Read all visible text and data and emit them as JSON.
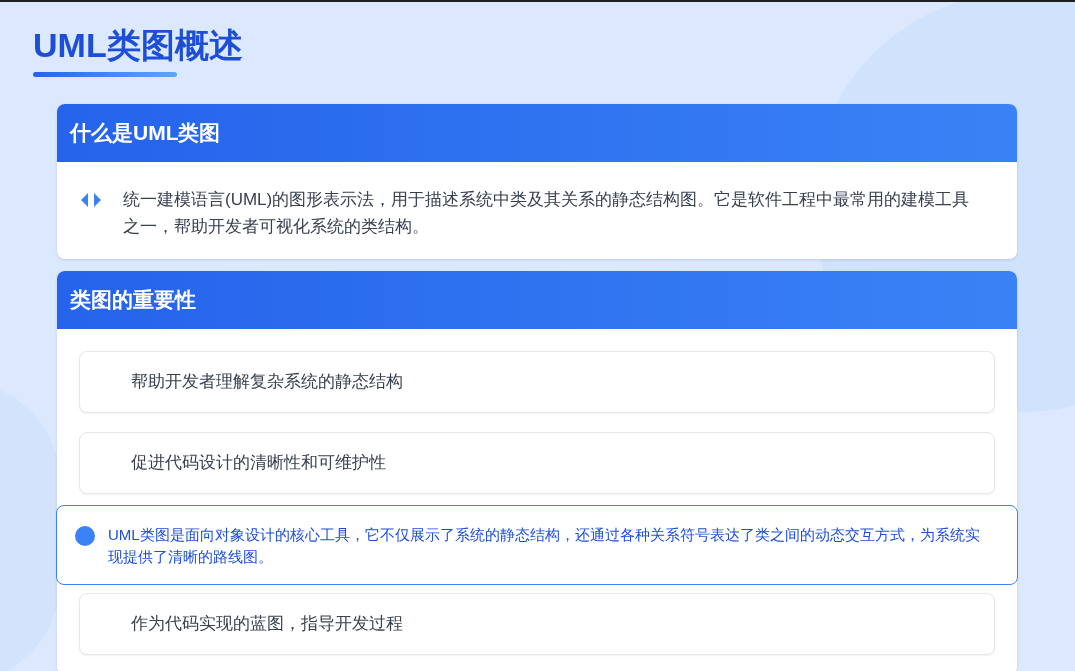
{
  "title": "UML类图概述",
  "sections": [
    {
      "heading": "什么是UML类图",
      "kind": "definition",
      "text": "统一建模语言(UML)的图形表示法，用于描述系统中类及其关系的静态结构图。它是软件工程中最常用的建模工具之一，帮助开发者可视化系统的类结构。"
    },
    {
      "heading": "类图的重要性",
      "kind": "list",
      "items": [
        {
          "kind": "point",
          "text": "帮助开发者理解复杂系统的静态结构"
        },
        {
          "kind": "point",
          "text": "促进代码设计的清晰性和可维护性"
        },
        {
          "kind": "callout",
          "text": "UML类图是面向对象设计的核心工具，它不仅展示了系统的静态结构，还通过各种关系符号表达了类之间的动态交互方式，为系统实现提供了清晰的路线图。"
        },
        {
          "kind": "point",
          "text": "作为代码实现的蓝图，指导开发过程"
        }
      ]
    }
  ]
}
